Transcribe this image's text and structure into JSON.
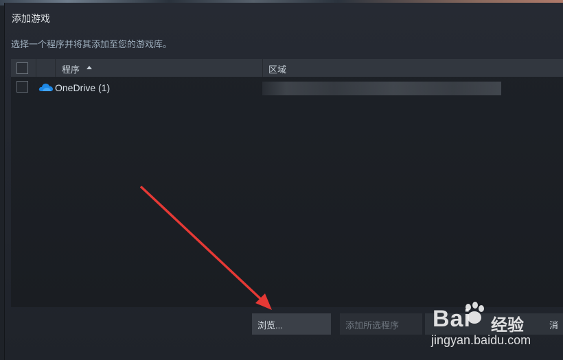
{
  "dialog": {
    "title": "添加游戏",
    "description": "选择一个程序并将其添加至您的游戏库。"
  },
  "list": {
    "columns": {
      "program": "程序",
      "area": "区域"
    },
    "rows": [
      {
        "label": "OneDrive (1)",
        "icon": "onedrive-cloud-icon"
      }
    ]
  },
  "buttons": {
    "browse": "浏览...",
    "add_selected": "添加所选程序",
    "cancel": "消"
  },
  "watermark": {
    "logo": "Bai",
    "text": "经验",
    "url": "jingyan.baidu.com"
  },
  "colors": {
    "arrow": "#e53935",
    "onedrive": "#1e88e5"
  }
}
